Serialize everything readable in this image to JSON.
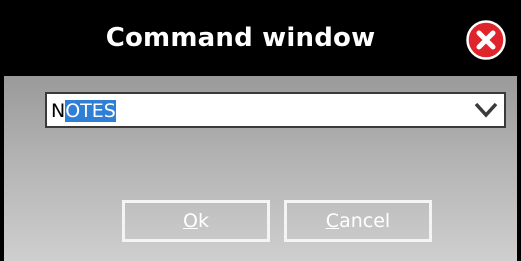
{
  "window": {
    "title": "Command window"
  },
  "command": {
    "value_first_char": "N",
    "value_selected": "OTES"
  },
  "buttons": {
    "ok_mnemonic": "O",
    "ok_rest": "k",
    "cancel_mnemonic": "C",
    "cancel_rest": "ancel"
  },
  "icons": {
    "close": "close-icon",
    "dropdown": "chevron-down-icon"
  },
  "colors": {
    "titlebar": "#000000",
    "close_red": "#e0242b",
    "selection": "#2f7fd6"
  }
}
